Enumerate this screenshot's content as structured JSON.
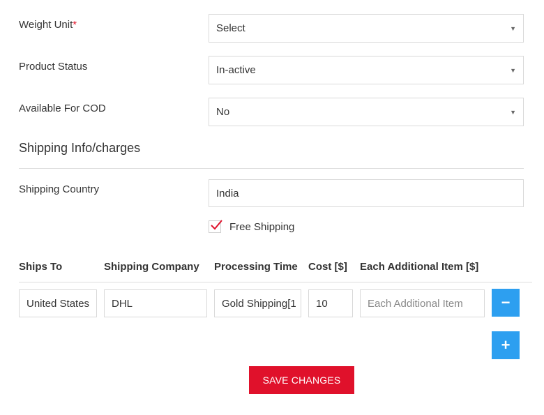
{
  "form": {
    "weight_unit": {
      "label": "Weight Unit",
      "required_mark": "*",
      "value": "Select"
    },
    "product_status": {
      "label": "Product Status",
      "value": "In-active"
    },
    "available_cod": {
      "label": "Available For COD",
      "value": "No"
    }
  },
  "shipping": {
    "heading": "Shipping Info/charges",
    "country_label": "Shipping Country",
    "country_value": "India",
    "free_shipping_label": "Free Shipping",
    "free_shipping_checked": true,
    "columns": [
      "Ships To",
      "Shipping Company",
      "Processing Time",
      "Cost [$]",
      "Each Additional Item [$]"
    ],
    "row": {
      "ships_to": "United States",
      "company": "DHL",
      "processing_time": "Gold Shipping[1",
      "cost": "10",
      "additional_placeholder": "Each Additional Item"
    }
  },
  "icons": {
    "caret": "caret-down-icon",
    "check": "checkmark-icon",
    "minus": "minus-icon",
    "plus": "plus-icon"
  },
  "colors": {
    "accent": "#2d9ff0",
    "save": "#e0112b",
    "required": "#e3192e"
  },
  "actions": {
    "save_label": "SAVE CHANGES",
    "minus_glyph": "−",
    "plus_glyph": "+"
  }
}
